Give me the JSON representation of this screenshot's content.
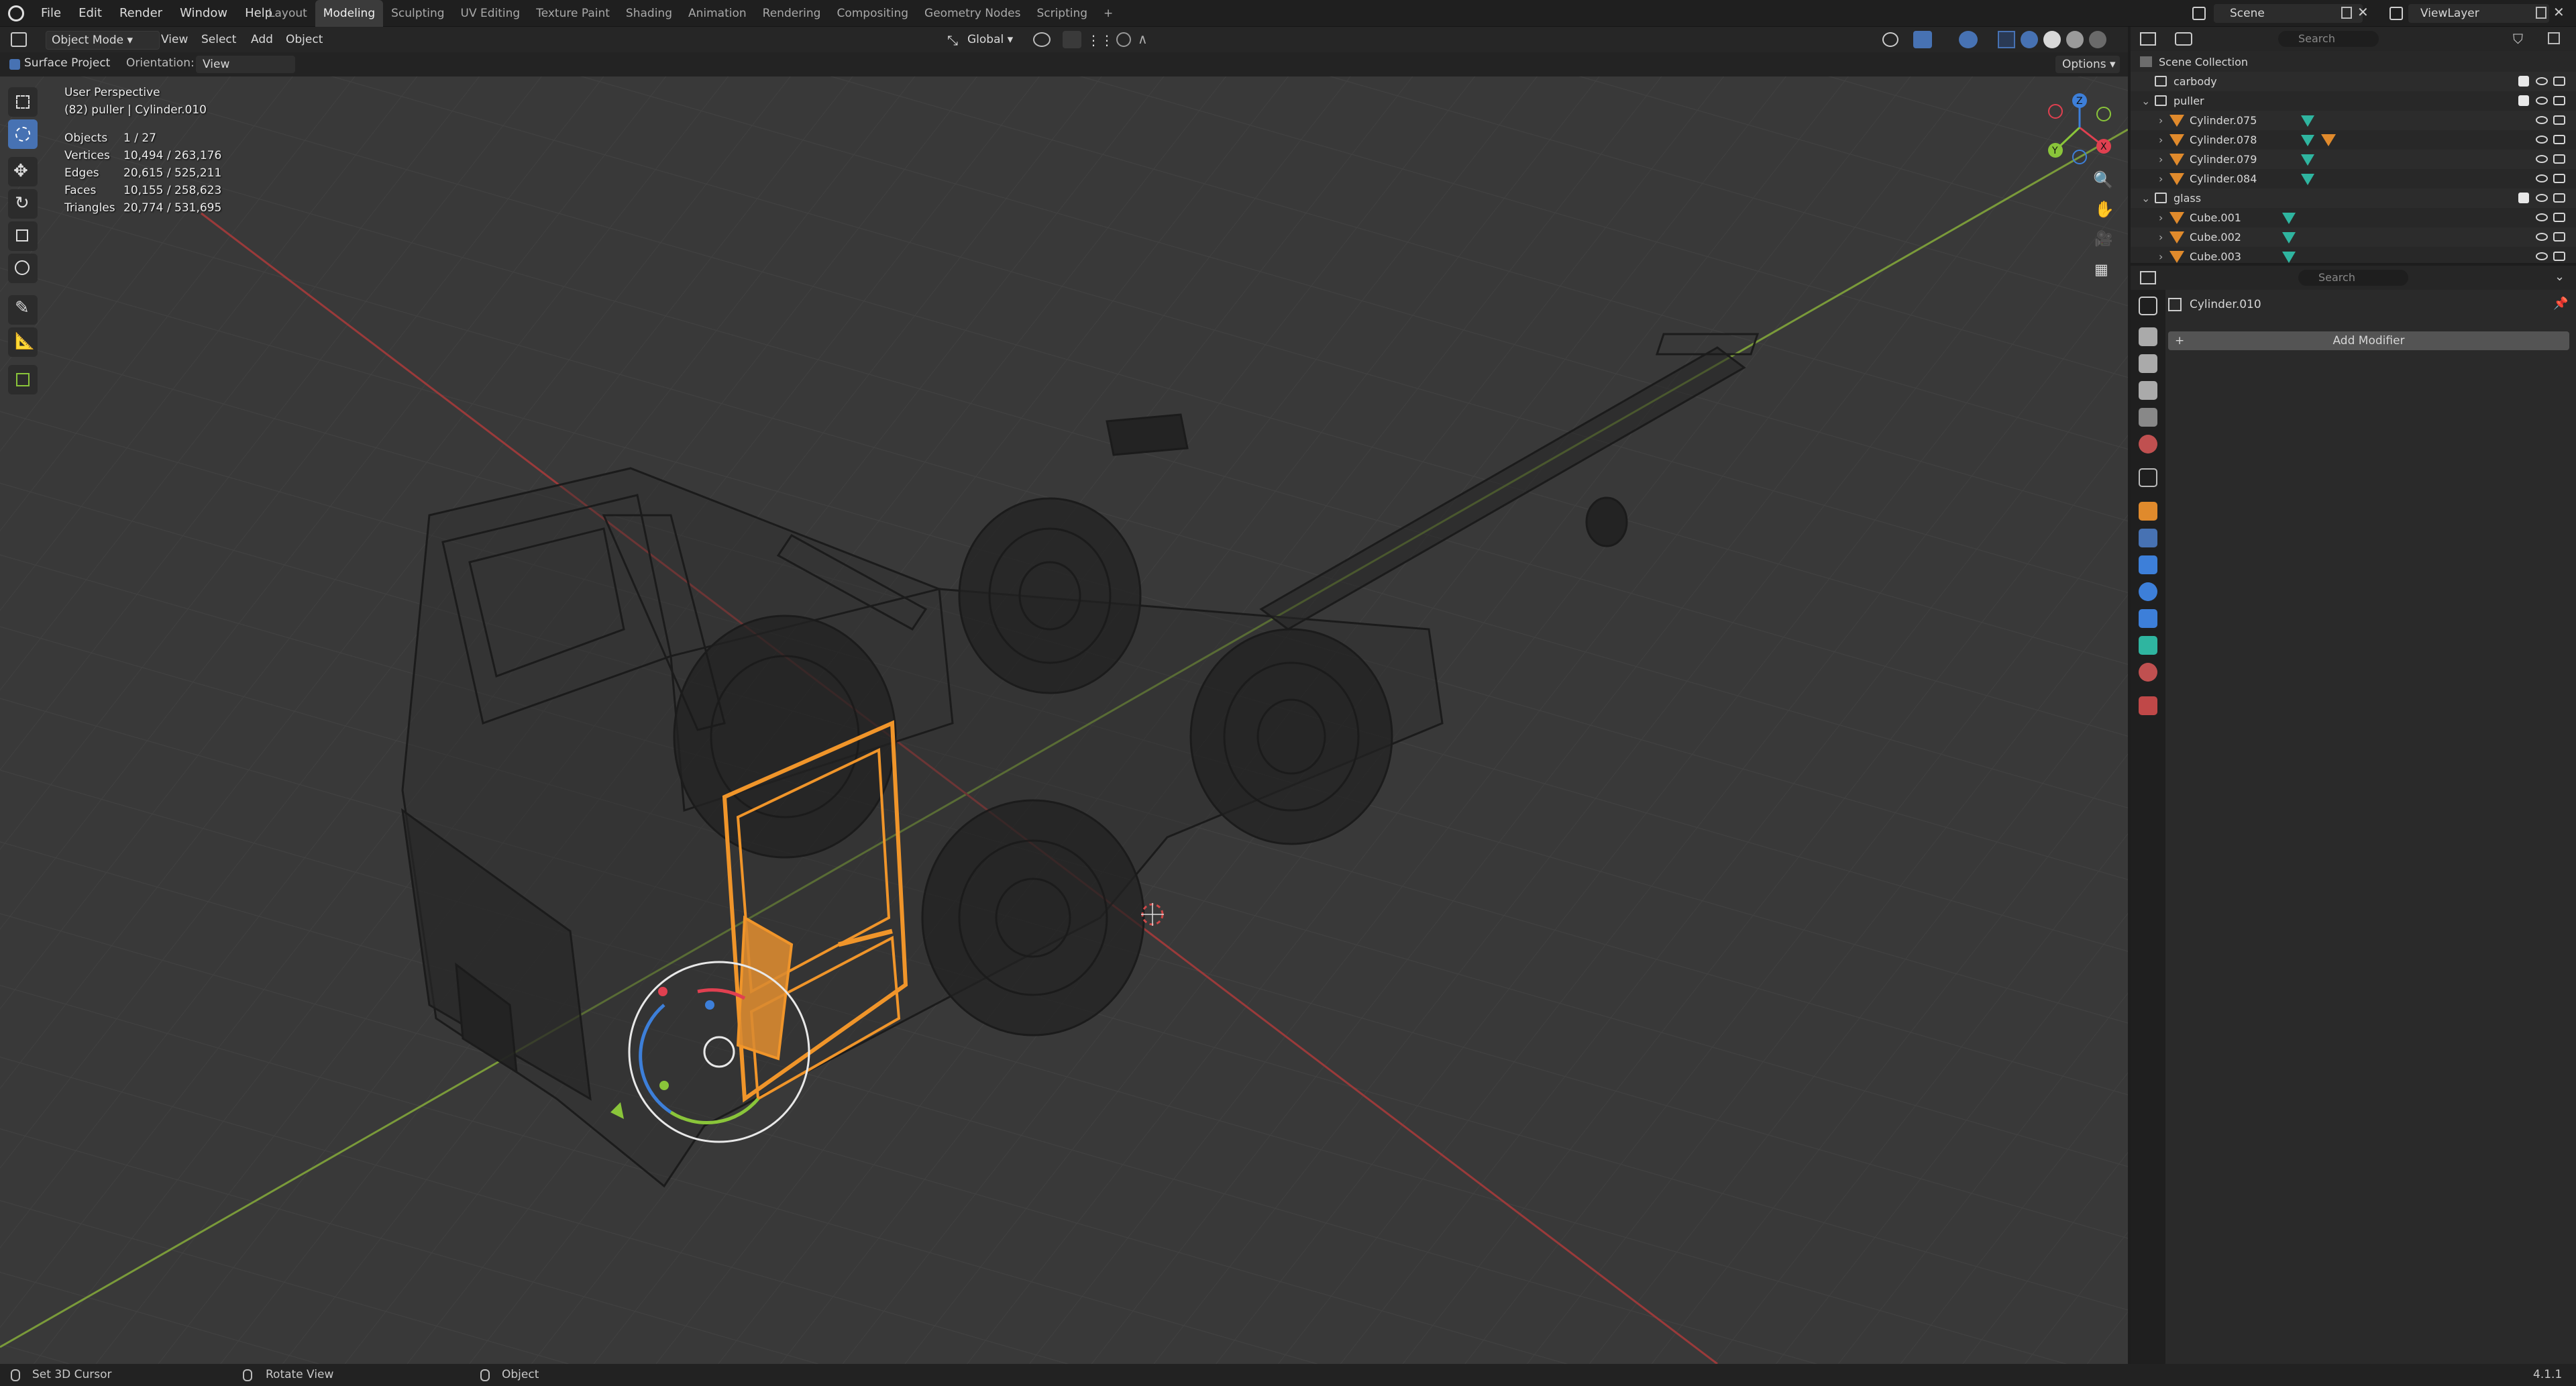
{
  "menus": [
    "File",
    "Edit",
    "Render",
    "Window",
    "Help"
  ],
  "workspaces": [
    "Layout",
    "Modeling",
    "Sculpting",
    "UV Editing",
    "Texture Paint",
    "Shading",
    "Animation",
    "Rendering",
    "Compositing",
    "Geometry Nodes",
    "Scripting"
  ],
  "active_workspace": "Modeling",
  "add_workspace_label": "+",
  "scene": {
    "label": "Scene",
    "view_layer": "ViewLayer"
  },
  "viewport_header": {
    "mode": "Object Mode",
    "menus": [
      "View",
      "Select",
      "Add",
      "Object"
    ],
    "transform_orientation": "Global"
  },
  "tool_settings": {
    "surface_project_label": "Surface Project",
    "orientation_label": "Orientation:",
    "orientation_value": "View",
    "options_label": "Options"
  },
  "overlay": {
    "view_name": "User Perspective",
    "context": "(82) puller | Cylinder.010",
    "stats": [
      {
        "label": "Objects",
        "value": "1 / 27"
      },
      {
        "label": "Vertices",
        "value": "10,494 / 263,176"
      },
      {
        "label": "Edges",
        "value": "20,615 / 525,211"
      },
      {
        "label": "Faces",
        "value": "10,155 / 258,623"
      },
      {
        "label": "Triangles",
        "value": "20,774 / 531,695"
      }
    ]
  },
  "gizmo_axes": {
    "x": "X",
    "y": "Y",
    "z": "Z"
  },
  "outliner": {
    "search_placeholder": "Search",
    "root": "Scene Collection",
    "rows": [
      {
        "name": "carbody",
        "type": "collection",
        "indent": 1
      },
      {
        "name": "puller",
        "type": "collection",
        "indent": 1
      },
      {
        "name": "Cylinder.075",
        "type": "mesh",
        "indent": 2
      },
      {
        "name": "Cylinder.078",
        "type": "mesh",
        "indent": 2
      },
      {
        "name": "Cylinder.079",
        "type": "mesh",
        "indent": 2
      },
      {
        "name": "Cylinder.084",
        "type": "mesh",
        "indent": 2
      },
      {
        "name": "glass",
        "type": "collection",
        "indent": 1
      },
      {
        "name": "Cube.001",
        "type": "mesh",
        "indent": 2
      },
      {
        "name": "Cube.002",
        "type": "mesh",
        "indent": 2
      },
      {
        "name": "Cube.003",
        "type": "mesh",
        "indent": 2
      }
    ]
  },
  "properties": {
    "search_placeholder": "Search",
    "object_name": "Cylinder.010",
    "add_modifier_label": "Add Modifier"
  },
  "statusbar": {
    "left": "Set 3D Cursor",
    "middle": "Rotate View",
    "right": "Object",
    "version": "4.1.1"
  },
  "colors": {
    "selection": "#f0952a",
    "active_tool": "#4772b3",
    "x_axis": "#e04050",
    "y_axis": "#8ac53a",
    "z_axis": "#3d7fd9"
  }
}
